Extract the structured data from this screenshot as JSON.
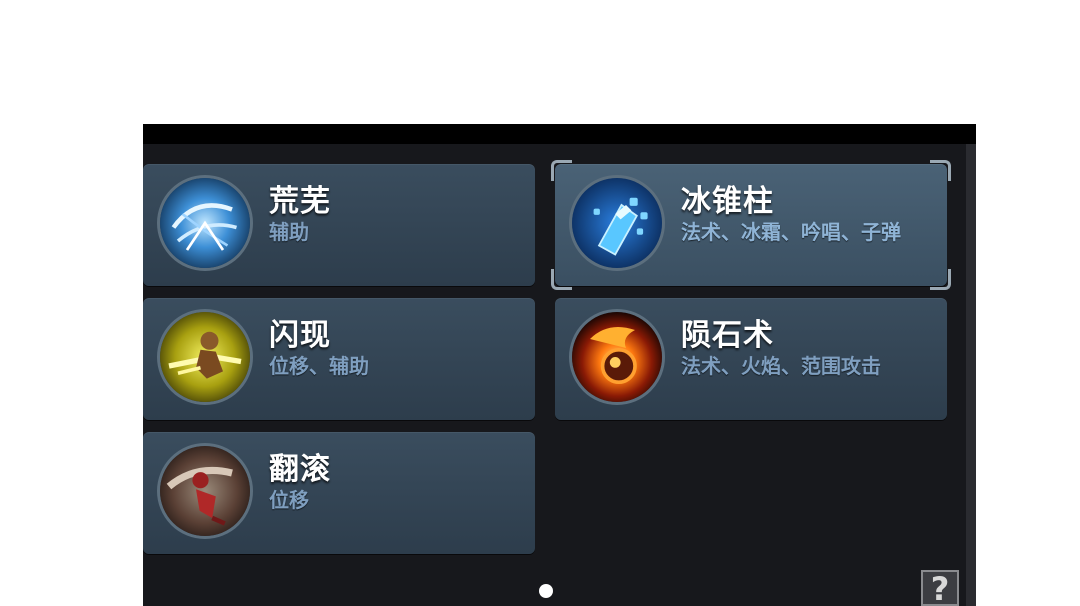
{
  "skills": [
    {
      "name": "荒芜",
      "tags": "辅助",
      "icon": "wind-swirl-icon",
      "selected": false
    },
    {
      "name": "冰锥柱",
      "tags": "法术、冰霜、吟唱、子弹",
      "icon": "ice-shard-icon",
      "selected": true
    },
    {
      "name": "闪现",
      "tags": "位移、辅助",
      "icon": "dash-figure-icon",
      "selected": false
    },
    {
      "name": "陨石术",
      "tags": "法术、火焰、范围攻击",
      "icon": "meteor-fire-icon",
      "selected": false
    },
    {
      "name": "翻滚",
      "tags": "位移",
      "icon": "roll-figure-icon",
      "selected": false
    }
  ],
  "pagination": {
    "pages": 1,
    "current": 1
  },
  "help": {
    "label": "?"
  },
  "colors": {
    "panel": "#17181c",
    "card": "#2d3d4c",
    "card_selected": "#3a4f61",
    "tag_text": "#7f9fc0",
    "name_text": "#ffffff"
  }
}
